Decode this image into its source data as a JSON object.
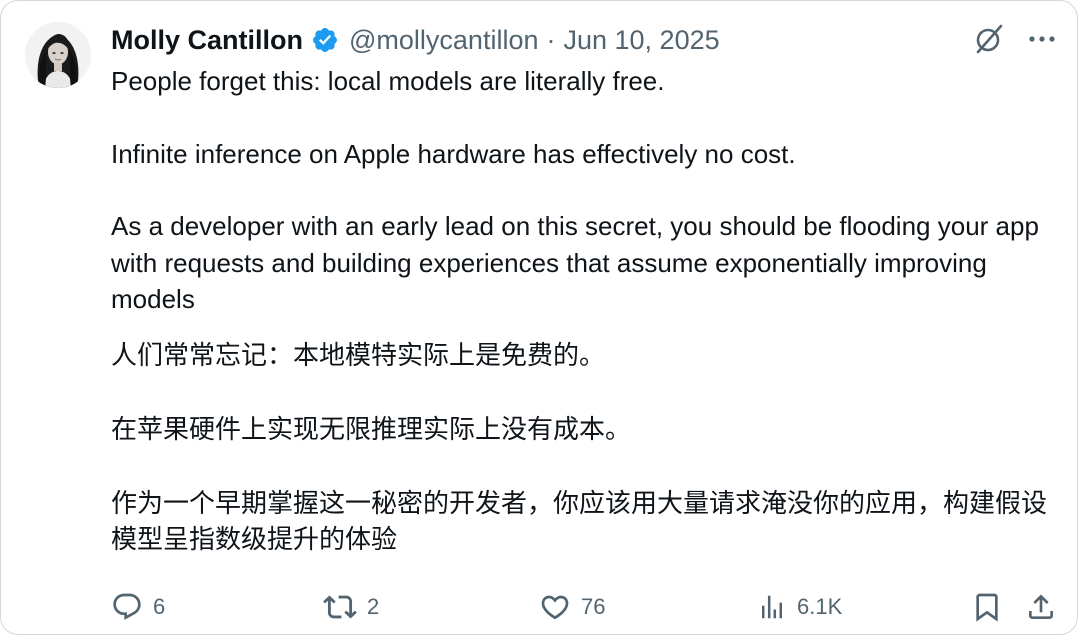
{
  "author": {
    "name": "Molly Cantillon",
    "handle": "@mollycantillon",
    "separator": "·",
    "date": "Jun 10, 2025"
  },
  "tweet": {
    "paragraphs_en": [
      "People forget this: local models are literally free.",
      "Infinite inference on Apple hardware has effectively no cost.",
      "As a developer with an early lead on this secret, you should be flooding your app with requests and building experiences that assume exponentially improving models"
    ],
    "paragraphs_cn": [
      "人们常常忘记：本地模特实际上是免费的。",
      "在苹果硬件上实现无限推理实际上没有成本。",
      "作为一个早期掌握这一秘密的开发者，你应该用大量请求淹没你的应用，构建假设模型呈指数级提升的体验"
    ]
  },
  "metrics": {
    "replies": "6",
    "reposts": "2",
    "likes": "76",
    "views": "6.1K"
  },
  "icons": {
    "verified": "verified-badge-icon",
    "grok": "grok-icon",
    "more": "more-options-icon",
    "reply": "reply-icon",
    "repost": "repost-icon",
    "like": "like-icon",
    "views": "views-icon",
    "bookmark": "bookmark-icon",
    "share": "share-icon"
  },
  "colors": {
    "text": "#0f1419",
    "secondary": "#536471",
    "verified": "#1d9bf0",
    "border": "#cfd9de"
  }
}
